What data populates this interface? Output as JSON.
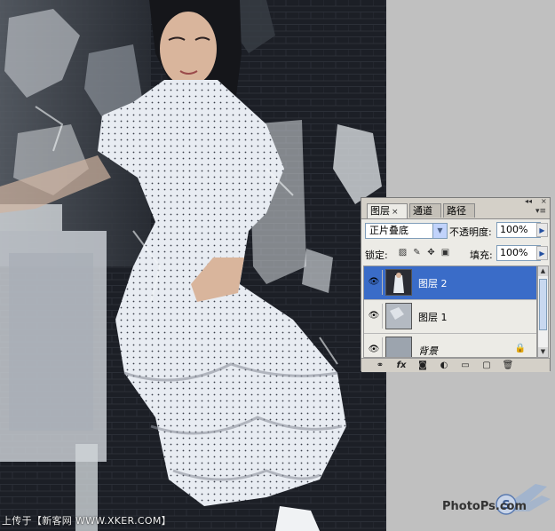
{
  "panel": {
    "tabs": [
      {
        "label": "图层",
        "close": "×"
      },
      {
        "label": "通道"
      },
      {
        "label": "路径"
      }
    ],
    "blend_mode": "正片叠底",
    "opacity_label": "不透明度:",
    "opacity_value": "100%",
    "lock_label": "锁定:",
    "fill_label": "填充:",
    "fill_value": "100%",
    "layers": [
      {
        "name": "图层 2",
        "selected": true
      },
      {
        "name": "图层 1",
        "selected": false
      },
      {
        "name": "背景",
        "selected": false,
        "locked": true
      }
    ],
    "icons": [
      "link-icon",
      "fx-icon",
      "mask-icon",
      "adjustment-icon",
      "folder-icon",
      "new-layer-icon",
      "trash-icon"
    ],
    "fx_text": "fx"
  },
  "watermark": {
    "upload_text": "上传于【新客网 WWW.XKER.COM】",
    "brand_text": "PhotoPs.com"
  },
  "colors": {
    "selection": "#3a6cc8",
    "panel_bg": "#d4d0c8",
    "workspace": "#c0c0c0"
  }
}
